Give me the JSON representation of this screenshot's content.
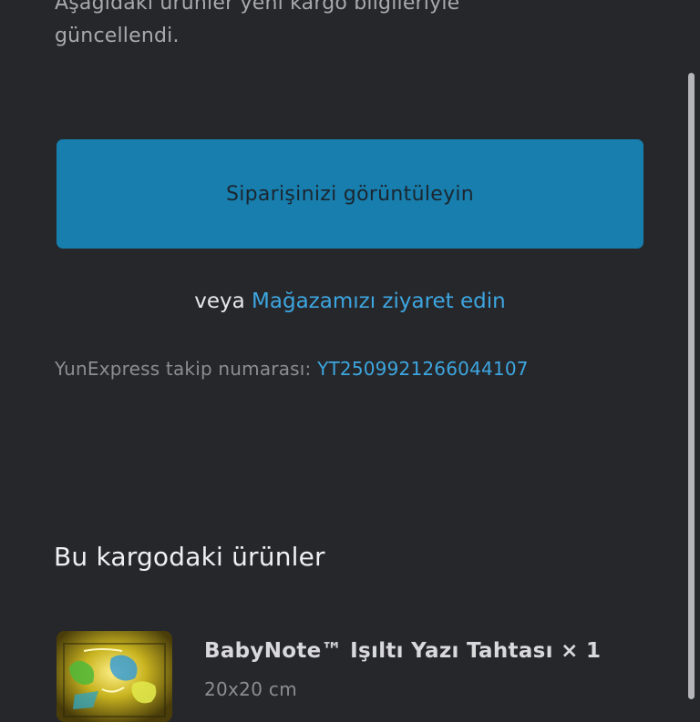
{
  "intro": {
    "text": "Aşağıdaki ürünler yeni kargo bilgileriyle güncellendi."
  },
  "actions": {
    "view_order_label": "Siparişinizi görüntüleyin",
    "or_text": "veya",
    "store_link_label": "Mağazamızı ziyaret edin"
  },
  "tracking": {
    "label": "YunExpress takip numarası:",
    "number": "YT2509921266044107"
  },
  "shipment": {
    "heading": "Bu kargodaki ürünler",
    "items": [
      {
        "title": "BabyNote™ Işıltı Yazı Tahtası × 1",
        "variant": "20x20 cm",
        "image_icon": "glow-drawing-board-product-image"
      }
    ]
  },
  "colors": {
    "background": "#26272b",
    "primary_button": "#177ead",
    "link": "#3da6e0",
    "muted_text": "#8c8d91"
  }
}
